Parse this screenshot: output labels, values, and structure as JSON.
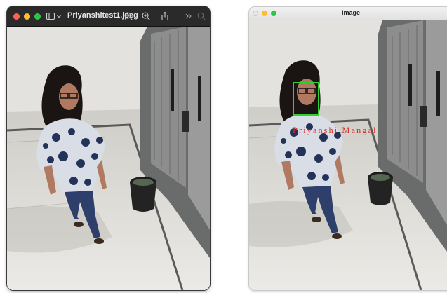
{
  "preview_window": {
    "file_name": "Priyanshitest1.jpeg",
    "toolbar_icons": [
      "sidebar-icon",
      "chevron-down-icon",
      "zoom-out-icon",
      "zoom-in-icon",
      "share-icon",
      "more-icon",
      "search-icon"
    ]
  },
  "opencv_window": {
    "title": "Image",
    "face_label": "Priyanshi Mangal"
  },
  "colors": {
    "face_box": "#2fd12f",
    "face_label": "#d8322a",
    "dark_titlebar": "#2b2a2b",
    "light_titlebar": "#e6e6e6"
  }
}
